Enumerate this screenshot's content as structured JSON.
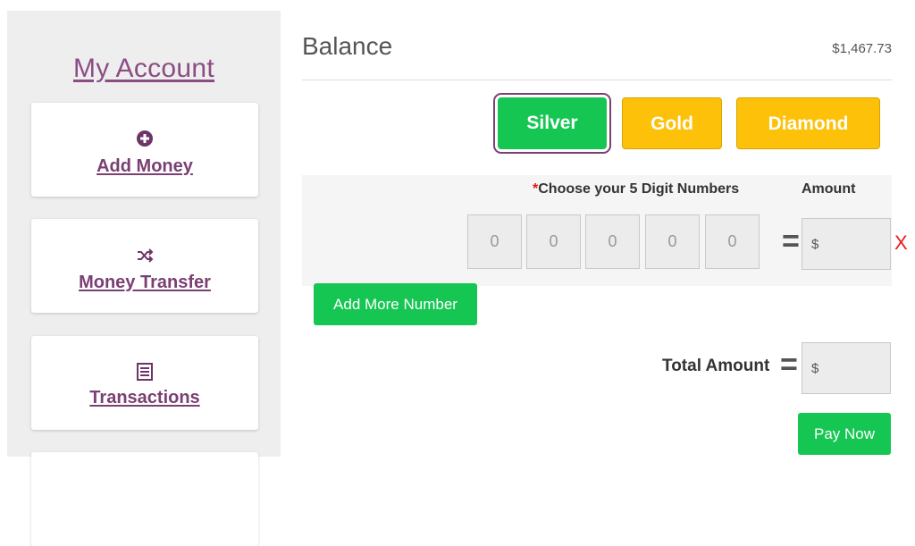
{
  "sidebar": {
    "title": "My Account",
    "items": [
      {
        "label": "Add Money",
        "icon": "plus-circle-icon"
      },
      {
        "label": "Money Transfer",
        "icon": "shuffle-icon"
      },
      {
        "label": "Transactions",
        "icon": "list-icon"
      }
    ]
  },
  "main": {
    "balance_label": "Balance",
    "balance_value": "$1,467.73",
    "tiers": [
      "Silver",
      "Gold",
      "Diamond"
    ],
    "selected_tier": "Silver",
    "table": {
      "required_mark": "*",
      "choose_label": "Choose your 5 Digit Numbers",
      "amount_label": "Amount"
    },
    "digits": [
      "0",
      "0",
      "0",
      "0",
      "0"
    ],
    "equals": "=",
    "currency": "$",
    "remove": "X",
    "add_more_label": "Add More Number",
    "total_label": "Total Amount",
    "pay_now_label": "Pay Now"
  },
  "colors": {
    "accent_purple": "#7a3f73",
    "green": "#16c653",
    "gold": "#fdc10a",
    "error_red": "#ea1c1c"
  }
}
